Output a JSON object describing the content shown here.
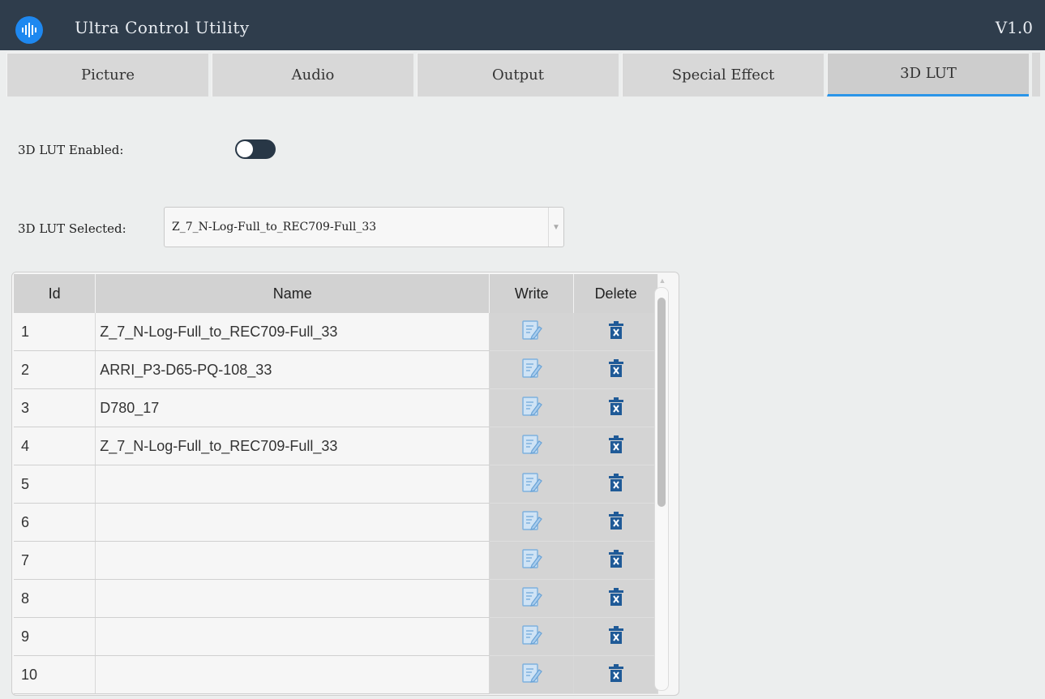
{
  "app": {
    "title": "Ultra Control Utility",
    "version": "V1.0",
    "logo_icon": "audio-wave-logo-icon"
  },
  "tabs": [
    {
      "label": "Picture",
      "active": false
    },
    {
      "label": "Audio",
      "active": false
    },
    {
      "label": "Output",
      "active": false
    },
    {
      "label": "Special Effect",
      "active": false
    },
    {
      "label": "3D LUT",
      "active": true
    }
  ],
  "lut": {
    "enabled_label": "3D LUT Enabled:",
    "enabled": false,
    "selected_label": "3D LUT Selected:",
    "selected_value": "Z_7_N-Log-Full_to_REC709-Full_33"
  },
  "table": {
    "headers": {
      "id": "Id",
      "name": "Name",
      "write": "Write",
      "delete": "Delete"
    },
    "rows": [
      {
        "id": "1",
        "name": "Z_7_N-Log-Full_to_REC709-Full_33"
      },
      {
        "id": "2",
        "name": "ARRI_P3-D65-PQ-108_33"
      },
      {
        "id": "3",
        "name": "D780_17"
      },
      {
        "id": "4",
        "name": "Z_7_N-Log-Full_to_REC709-Full_33"
      },
      {
        "id": "5",
        "name": ""
      },
      {
        "id": "6",
        "name": ""
      },
      {
        "id": "7",
        "name": ""
      },
      {
        "id": "8",
        "name": ""
      },
      {
        "id": "9",
        "name": ""
      },
      {
        "id": "10",
        "name": ""
      }
    ]
  },
  "colors": {
    "titlebar": "#2f3d4c",
    "accent": "#2b95e8",
    "toggle": "#283746",
    "delete_icon": "#1f5a97"
  }
}
